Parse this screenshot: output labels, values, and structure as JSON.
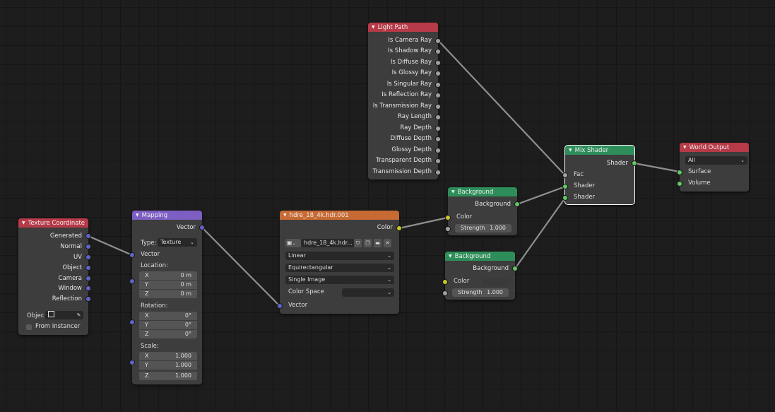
{
  "colors": {
    "input_header": "#b63a47",
    "converter_header": "#7d5ec3",
    "texture_header": "#c86a33",
    "shader_header": "#2e8e5a",
    "output_header": "#b63a47",
    "vector_socket": "#6363c7",
    "color_socket": "#c7c729",
    "shader_socket": "#63c763",
    "float_socket": "#a1a1a1"
  },
  "texture_coordinate": {
    "title": "Texture Coordinate",
    "outputs": [
      "Generated",
      "Normal",
      "UV",
      "Object",
      "Camera",
      "Window",
      "Reflection"
    ],
    "object_label": "Objec",
    "from_instancer": "From Instancer"
  },
  "mapping": {
    "title": "Mapping",
    "output": "Vector",
    "type_label": "Type:",
    "type_value": "Texture",
    "input": "Vector",
    "location_label": "Location:",
    "location": [
      {
        "axis": "X",
        "value": "0 m"
      },
      {
        "axis": "Y",
        "value": "0 m"
      },
      {
        "axis": "Z",
        "value": "0 m"
      }
    ],
    "rotation_label": "Rotation:",
    "rotation": [
      {
        "axis": "X",
        "value": "0°"
      },
      {
        "axis": "Y",
        "value": "0°"
      },
      {
        "axis": "Z",
        "value": "0°"
      }
    ],
    "scale_label": "Scale:",
    "scale": [
      {
        "axis": "X",
        "value": "1.000"
      },
      {
        "axis": "Y",
        "value": "1.000"
      },
      {
        "axis": "Z",
        "value": "1.000"
      }
    ]
  },
  "image_texture": {
    "title": "hdre_18_4k.hdr.001",
    "output": "Color",
    "image_name": "hdre_18_4k.hdr...",
    "interpolation": "Linear",
    "projection": "Equirectangular",
    "source": "Single Image",
    "color_space_label": "Color Space",
    "color_space_value": "",
    "input": "Vector"
  },
  "light_path": {
    "title": "Light Path",
    "outputs": [
      "Is Camera Ray",
      "Is Shadow Ray",
      "Is Diffuse Ray",
      "Is Glossy Ray",
      "Is Singular Ray",
      "Is Reflection Ray",
      "Is Transmission Ray",
      "Ray Length",
      "Ray Depth",
      "Diffuse Depth",
      "Glossy Depth",
      "Transparent Depth",
      "Transmission Depth"
    ]
  },
  "background_1": {
    "title": "Background",
    "output": "Background",
    "color_label": "Color",
    "strength_label": "Strength",
    "strength_value": "1.000"
  },
  "background_2": {
    "title": "Background",
    "output": "Background",
    "color_label": "Color",
    "strength_label": "Strength",
    "strength_value": "1.000"
  },
  "mix_shader": {
    "title": "Mix Shader",
    "output": "Shader",
    "inputs": [
      "Fac",
      "Shader",
      "Shader"
    ]
  },
  "world_output": {
    "title": "World Output",
    "target": "All",
    "inputs": [
      "Surface",
      "Volume"
    ]
  }
}
